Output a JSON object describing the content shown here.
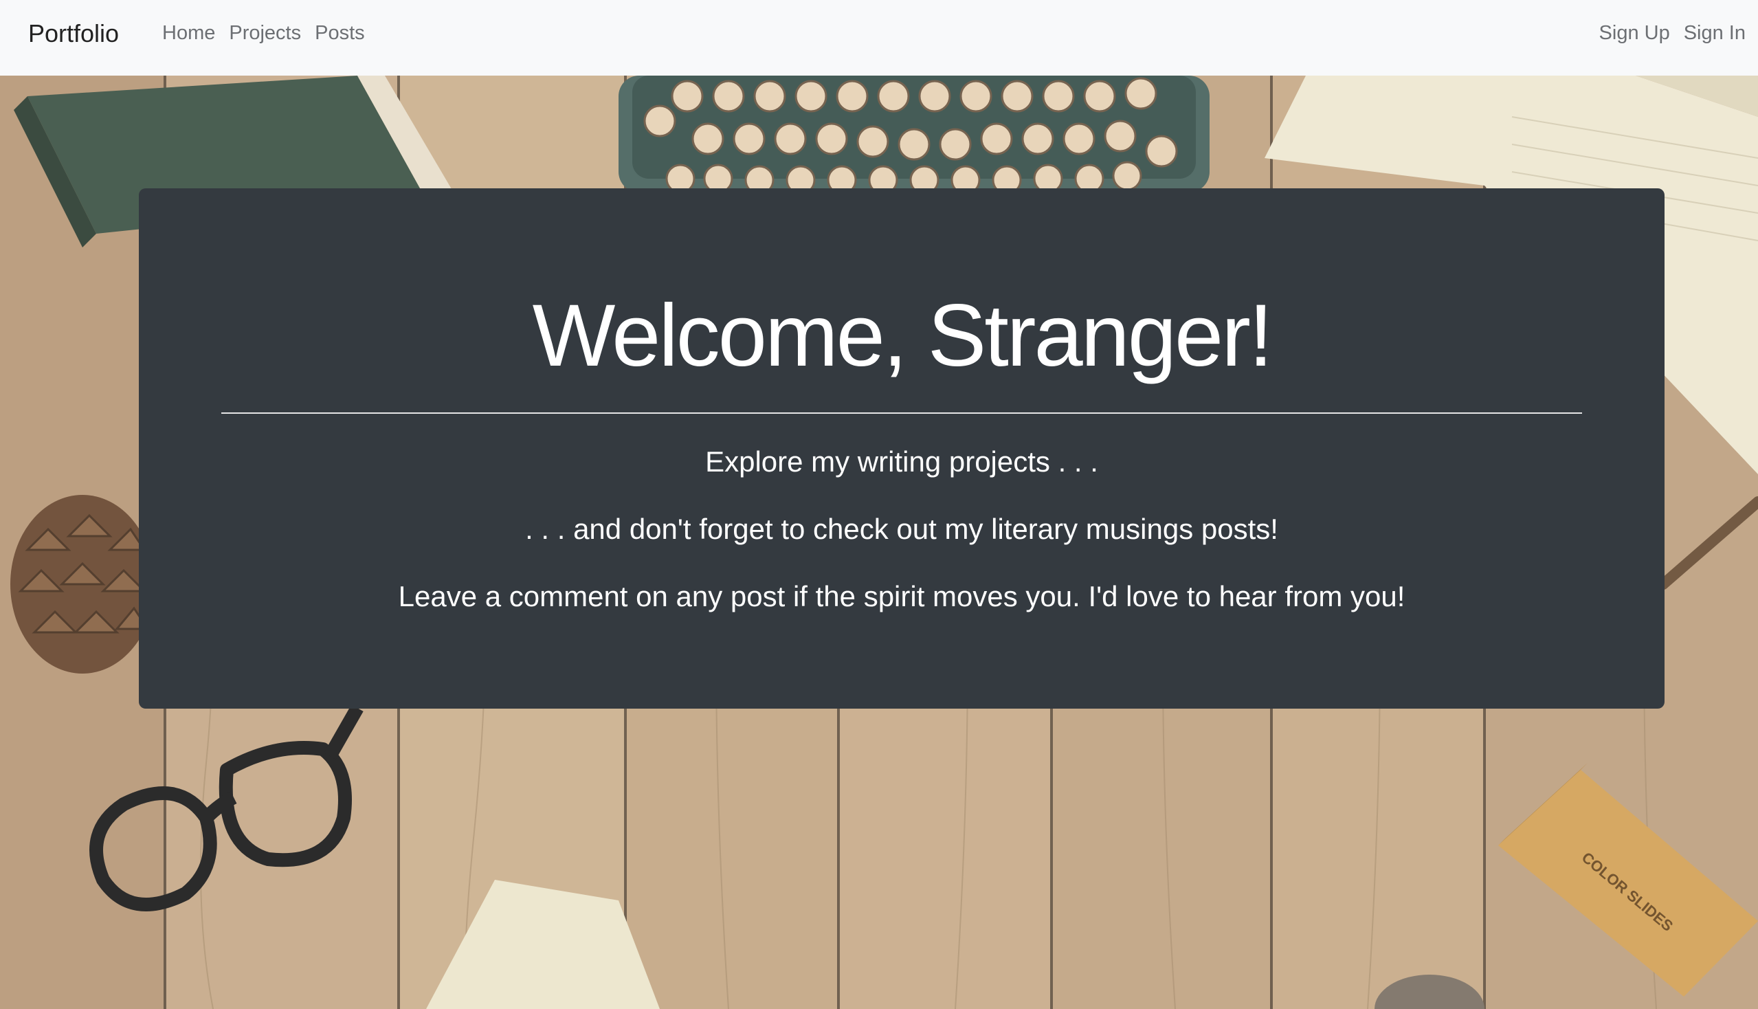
{
  "navbar": {
    "brand": "Portfolio",
    "links": [
      {
        "label": "Home"
      },
      {
        "label": "Projects"
      },
      {
        "label": "Posts"
      }
    ],
    "auth": [
      {
        "label": "Sign Up"
      },
      {
        "label": "Sign In"
      }
    ]
  },
  "hero": {
    "title": "Welcome, Stranger!",
    "lines": [
      "Explore my writing projects . . .",
      ". . . and don't forget to check out my literary musings posts!",
      "Leave a comment on any post if the spirit moves you. I'd love to hear from you!"
    ]
  },
  "background": {
    "description_icons": [
      "typewriter",
      "book",
      "notepad",
      "pine-cone",
      "glasses",
      "slide-box"
    ],
    "slide_box_label": "COLOR SLIDES"
  },
  "colors": {
    "navbar_bg": "#f8f9fa",
    "jumbotron_bg": "#343a40",
    "nav_link": "#6c6f73",
    "brand": "#222222"
  }
}
